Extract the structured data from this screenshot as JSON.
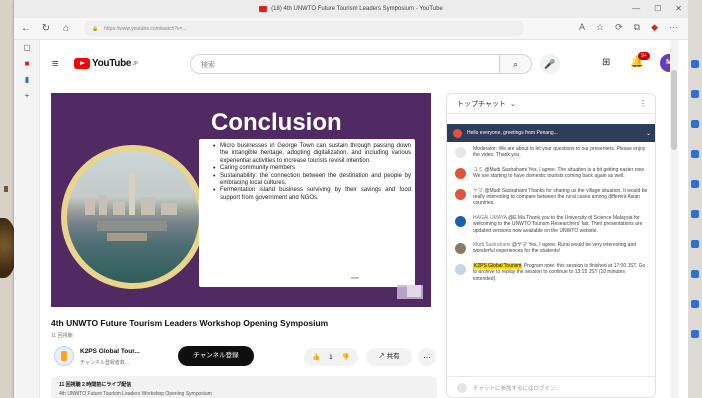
{
  "browser": {
    "tab_title": "(18) 4th UNWTO Future Tourism Leaders Symposium - YouTube",
    "url": "https://www.youtube.com/watch?v=..."
  },
  "youtube": {
    "logo_text": "YouTube",
    "logo_region": "JP",
    "search_placeholder": "検索",
    "notifications_count": "9+",
    "avatar_initial": "M"
  },
  "slide": {
    "title": "Conclusion",
    "bullets": [
      "Micro businesses in George Town can sustain through passing down the intangible heritage, adopting digitalization, and including various experiential activities to increase tourists revisit intention.",
      "Caring community members",
      "Sustainability: the connection between the destination and people by embracing local cultures.",
      "Fermentation island business surviving by their savings and food support from government and NGOs."
    ],
    "page_marker": "****"
  },
  "video": {
    "title": "4th UNWTO Future Tourism Leaders Workshop Opening Symposium",
    "views": "11 回視聴",
    "channel_name": "K2PS Global Tour...",
    "channel_subs": "チャンネル登録者数...",
    "subscribe_label": "チャンネル登録",
    "like_count": "1",
    "share_label": "共有",
    "more_label": "…",
    "description_meta": "11 回視聴 2 時間前にライブ配信",
    "description_text": "4th UNWTO Future Tourism Leaders Workshop Opening Symposium"
  },
  "chat": {
    "header": "トップチャット",
    "pinned": "Hello everyone, greetings from Penang...",
    "messages": [
      {
        "name": "",
        "text": "Moderator: We are about to let your questions to our presenters. Please enjoy the video. Thank you.",
        "color": "#e6e6e6"
      },
      {
        "name": "ユミ",
        "text": "@Mudi Sastrahami Yes, I agree. The situation is a bit getting easier now. We are starting to have domestic tourists coming back again as well.",
        "color": "#e0533b"
      },
      {
        "name": "ヤマ",
        "text": "@Mudi Sastrahami Thanks for sharing us the village situation. It would be really interesting to compare between the rural cases among different Asian countries.",
        "color": "#e0533b"
      },
      {
        "name": "HAGAI UMAYA",
        "text": "@E Ma Thank you to the University of Science Malaysia for welcoming to the UNWTO Tourism Researchers' fair. Their presentations are updated versions now available on the UNWTO website.",
        "color": "#1a5fb4"
      },
      {
        "name": "Mudi Sastrahami",
        "text": "@ヤマ Yes, I agree. Rural would be very interesting and wonderful experiences for the students!",
        "color": "#8a7a6a"
      },
      {
        "name": "K2PS Global Tourism",
        "text": "Program note: this session is finished at 17:00 JST. Go to archive to replay the session to continue to 13:15 JST (10 minutes extended).",
        "color": "#c9d4e6",
        "highlight": true
      }
    ],
    "input_placeholder": "チャットに参加するにはログイン..."
  }
}
